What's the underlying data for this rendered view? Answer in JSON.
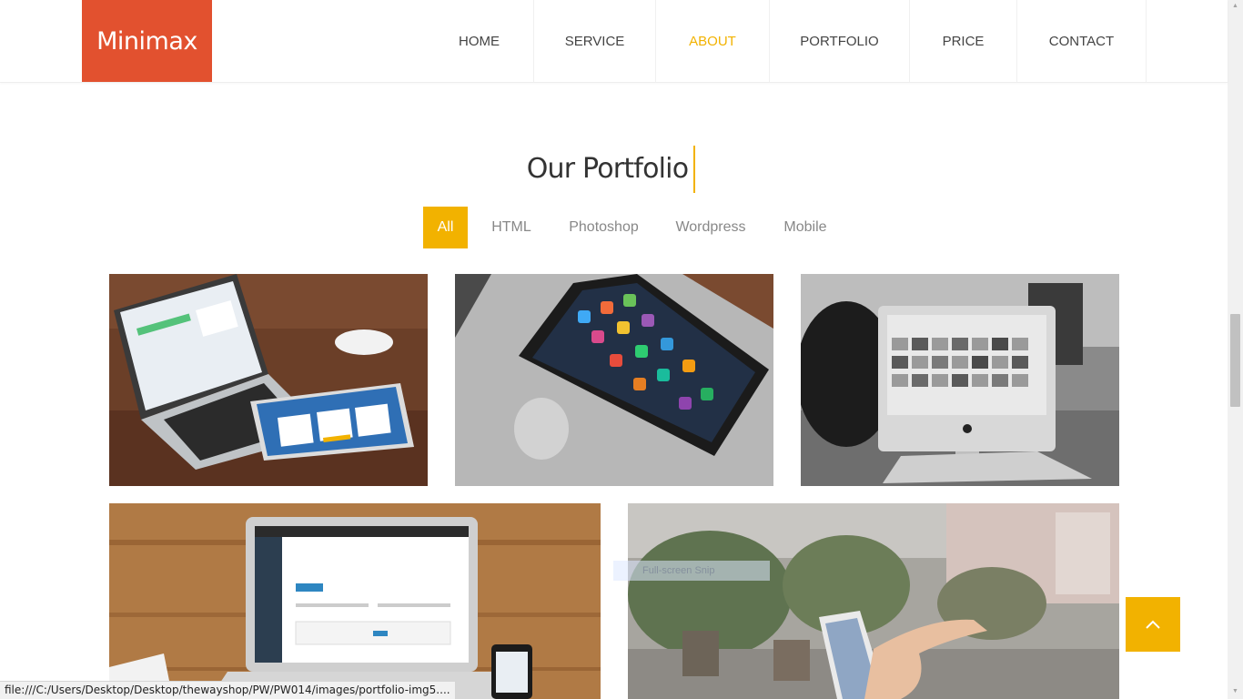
{
  "header": {
    "logo": "Minimax",
    "nav": [
      {
        "label": "HOME",
        "active": false
      },
      {
        "label": "SERVICE",
        "active": false
      },
      {
        "label": "ABOUT",
        "active": true
      },
      {
        "label": "PORTFOLIO",
        "active": false
      },
      {
        "label": "PRICE",
        "active": false
      },
      {
        "label": "CONTACT",
        "active": false
      }
    ]
  },
  "portfolio": {
    "title": "Our Portfolio",
    "filters": [
      {
        "label": "All",
        "active": true
      },
      {
        "label": "HTML",
        "active": false
      },
      {
        "label": "Photoshop",
        "active": false
      },
      {
        "label": "Wordpress",
        "active": false
      },
      {
        "label": "Mobile",
        "active": false
      }
    ],
    "items": [
      {
        "subject": "laptop-and-tablet-photo"
      },
      {
        "subject": "smartphone-on-laptop-photo"
      },
      {
        "subject": "person-at-desktop-computer-photo"
      },
      {
        "subject": "laptop-on-wooden-desk-photo"
      },
      {
        "subject": "hand-holding-phone-photo"
      }
    ]
  },
  "overlay": {
    "text": "Full-screen Snip"
  },
  "status_bar": {
    "url": "file:///C:/Users/Desktop/Desktop/thewayshop/PW/PW014/images/portfolio-img5...."
  },
  "back_to_top": {
    "icon": "chevron-up-icon"
  },
  "colors": {
    "accent": "#f2b200",
    "brand": "#e2512f",
    "text": "#333333"
  }
}
